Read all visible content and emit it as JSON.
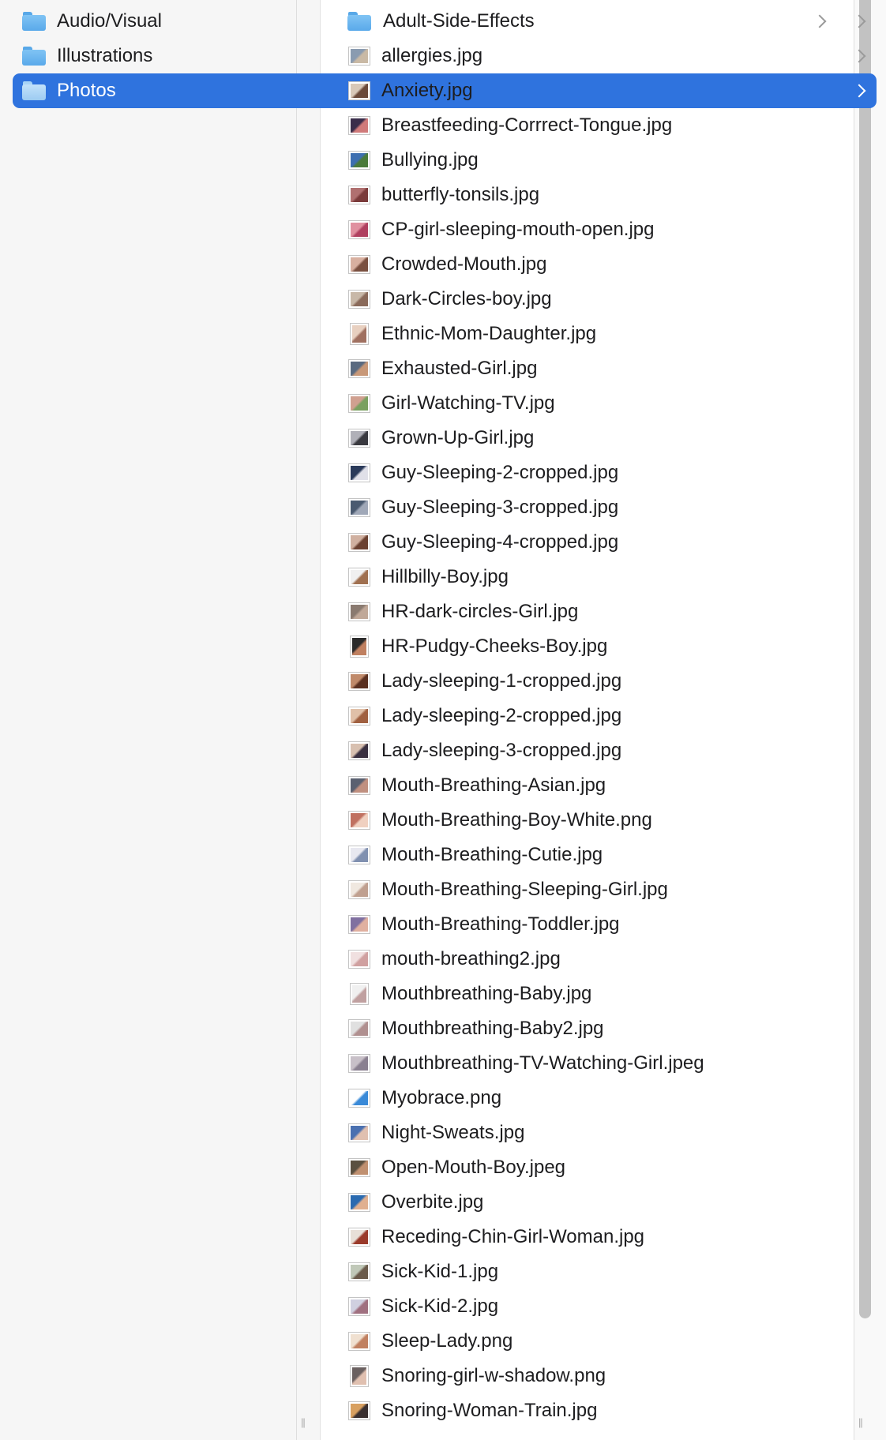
{
  "sidebar": {
    "items": [
      {
        "label": "Audio/Visual",
        "selected": false
      },
      {
        "label": "Illustrations",
        "selected": false
      },
      {
        "label": "Photos",
        "selected": true
      }
    ]
  },
  "files": {
    "folder": {
      "label": "Adult-Side-Effects"
    },
    "items": [
      {
        "label": "allergies.jpg"
      },
      {
        "label": "Anxiety.jpg"
      },
      {
        "label": "Breastfeeding-Corrrect-Tongue.jpg"
      },
      {
        "label": "Bullying.jpg"
      },
      {
        "label": "butterfly-tonsils.jpg"
      },
      {
        "label": "CP-girl-sleeping-mouth-open.jpg"
      },
      {
        "label": "Crowded-Mouth.jpg"
      },
      {
        "label": "Dark-Circles-boy.jpg"
      },
      {
        "label": "Ethnic-Mom-Daughter.jpg"
      },
      {
        "label": "Exhausted-Girl.jpg"
      },
      {
        "label": "Girl-Watching-TV.jpg"
      },
      {
        "label": "Grown-Up-Girl.jpg"
      },
      {
        "label": "Guy-Sleeping-2-cropped.jpg"
      },
      {
        "label": "Guy-Sleeping-3-cropped.jpg"
      },
      {
        "label": "Guy-Sleeping-4-cropped.jpg"
      },
      {
        "label": "Hillbilly-Boy.jpg"
      },
      {
        "label": "HR-dark-circles-Girl.jpg"
      },
      {
        "label": "HR-Pudgy-Cheeks-Boy.jpg"
      },
      {
        "label": "Lady-sleeping-1-cropped.jpg"
      },
      {
        "label": "Lady-sleeping-2-cropped.jpg"
      },
      {
        "label": "Lady-sleeping-3-cropped.jpg"
      },
      {
        "label": "Mouth-Breathing-Asian.jpg"
      },
      {
        "label": "Mouth-Breathing-Boy-White.png"
      },
      {
        "label": "Mouth-Breathing-Cutie.jpg"
      },
      {
        "label": "Mouth-Breathing-Sleeping-Girl.jpg"
      },
      {
        "label": "Mouth-Breathing-Toddler.jpg"
      },
      {
        "label": "mouth-breathing2.jpg"
      },
      {
        "label": "Mouthbreathing-Baby.jpg"
      },
      {
        "label": "Mouthbreathing-Baby2.jpg"
      },
      {
        "label": "Mouthbreathing-TV-Watching-Girl.jpeg"
      },
      {
        "label": "Myobrace.png"
      },
      {
        "label": "Night-Sweats.jpg"
      },
      {
        "label": "Open-Mouth-Boy.jpeg"
      },
      {
        "label": "Overbite.jpg"
      },
      {
        "label": "Receding-Chin-Girl-Woman.jpg"
      },
      {
        "label": "Sick-Kid-1.jpg"
      },
      {
        "label": "Sick-Kid-2.jpg"
      },
      {
        "label": "Sleep-Lady.png"
      },
      {
        "label": "Snoring-girl-w-shadow.png"
      },
      {
        "label": "Snoring-Woman-Train.jpg"
      }
    ]
  },
  "colors": {
    "selection": "#2f73de",
    "folder_icon": "#6fb6f0",
    "sidebar_bg": "#f6f6f6"
  },
  "icons": {
    "folder": "folder-icon",
    "disclosure": "chevron-right-icon",
    "file_thumbnail": "image-thumbnail-icon",
    "resize": "column-resize-icon"
  }
}
